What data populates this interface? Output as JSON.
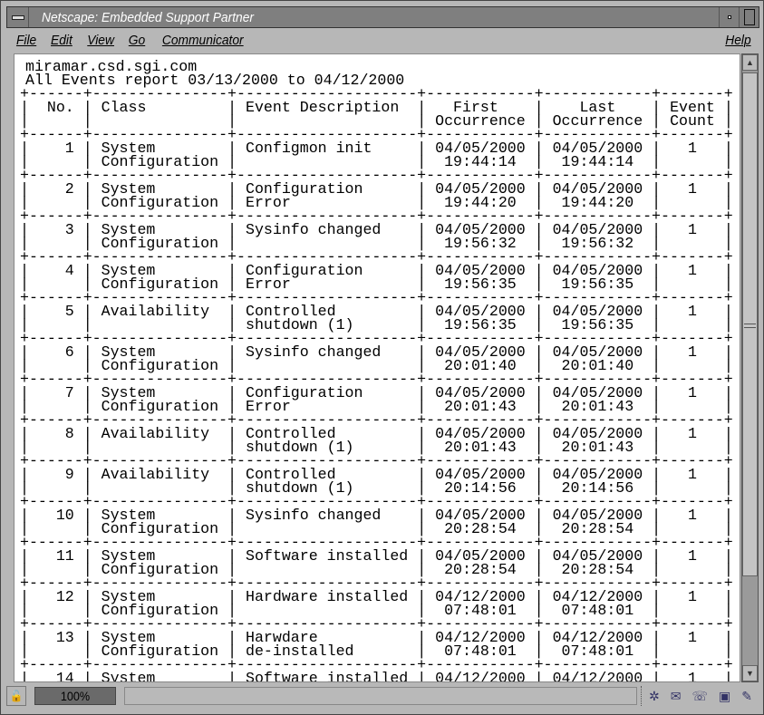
{
  "window": {
    "title": "Netscape: Embedded Support Partner"
  },
  "menu": [
    "File",
    "Edit",
    "View",
    "Go",
    "Communicator"
  ],
  "help": "Help",
  "report": {
    "host": "miramar.csd.sgi.com",
    "title": "All Events report 03/13/2000 to 04/12/2000",
    "headers": [
      [
        "No.",
        ""
      ],
      [
        "Class",
        ""
      ],
      [
        "Event Description",
        ""
      ],
      [
        "First",
        "Occurrence"
      ],
      [
        "Last",
        "Occurrence"
      ],
      [
        "Event",
        "Count"
      ]
    ],
    "rows": [
      {
        "no": "1",
        "class": [
          "System",
          "Configuration"
        ],
        "desc": [
          "Configmon init",
          ""
        ],
        "first": [
          "04/05/2000",
          "19:44:14"
        ],
        "last": [
          "04/05/2000",
          "19:44:14"
        ],
        "count": "1"
      },
      {
        "no": "2",
        "class": [
          "System",
          "Configuration"
        ],
        "desc": [
          "Configuration",
          "Error"
        ],
        "first": [
          "04/05/2000",
          "19:44:20"
        ],
        "last": [
          "04/05/2000",
          "19:44:20"
        ],
        "count": "1"
      },
      {
        "no": "3",
        "class": [
          "System",
          "Configuration"
        ],
        "desc": [
          "Sysinfo changed",
          ""
        ],
        "first": [
          "04/05/2000",
          "19:56:32"
        ],
        "last": [
          "04/05/2000",
          "19:56:32"
        ],
        "count": "1"
      },
      {
        "no": "4",
        "class": [
          "System",
          "Configuration"
        ],
        "desc": [
          "Configuration",
          "Error"
        ],
        "first": [
          "04/05/2000",
          "19:56:35"
        ],
        "last": [
          "04/05/2000",
          "19:56:35"
        ],
        "count": "1"
      },
      {
        "no": "5",
        "class": [
          "Availability",
          ""
        ],
        "desc": [
          "Controlled",
          "shutdown (1)"
        ],
        "first": [
          "04/05/2000",
          "19:56:35"
        ],
        "last": [
          "04/05/2000",
          "19:56:35"
        ],
        "count": "1"
      },
      {
        "no": "6",
        "class": [
          "System",
          "Configuration"
        ],
        "desc": [
          "Sysinfo changed",
          ""
        ],
        "first": [
          "04/05/2000",
          "20:01:40"
        ],
        "last": [
          "04/05/2000",
          "20:01:40"
        ],
        "count": "1"
      },
      {
        "no": "7",
        "class": [
          "System",
          "Configuration"
        ],
        "desc": [
          "Configuration",
          "Error"
        ],
        "first": [
          "04/05/2000",
          "20:01:43"
        ],
        "last": [
          "04/05/2000",
          "20:01:43"
        ],
        "count": "1"
      },
      {
        "no": "8",
        "class": [
          "Availability",
          ""
        ],
        "desc": [
          "Controlled",
          "shutdown (1)"
        ],
        "first": [
          "04/05/2000",
          "20:01:43"
        ],
        "last": [
          "04/05/2000",
          "20:01:43"
        ],
        "count": "1"
      },
      {
        "no": "9",
        "class": [
          "Availability",
          ""
        ],
        "desc": [
          "Controlled",
          "shutdown (1)"
        ],
        "first": [
          "04/05/2000",
          "20:14:56"
        ],
        "last": [
          "04/05/2000",
          "20:14:56"
        ],
        "count": "1"
      },
      {
        "no": "10",
        "class": [
          "System",
          "Configuration"
        ],
        "desc": [
          "Sysinfo changed",
          ""
        ],
        "first": [
          "04/05/2000",
          "20:28:54"
        ],
        "last": [
          "04/05/2000",
          "20:28:54"
        ],
        "count": "1"
      },
      {
        "no": "11",
        "class": [
          "System",
          "Configuration"
        ],
        "desc": [
          "Software installed",
          ""
        ],
        "first": [
          "04/05/2000",
          "20:28:54"
        ],
        "last": [
          "04/05/2000",
          "20:28:54"
        ],
        "count": "1"
      },
      {
        "no": "12",
        "class": [
          "System",
          "Configuration"
        ],
        "desc": [
          "Hardware installed",
          ""
        ],
        "first": [
          "04/12/2000",
          "07:48:01"
        ],
        "last": [
          "04/12/2000",
          "07:48:01"
        ],
        "count": "1"
      },
      {
        "no": "13",
        "class": [
          "System",
          "Configuration"
        ],
        "desc": [
          "Harwdare",
          "de-installed"
        ],
        "first": [
          "04/12/2000",
          "07:48:01"
        ],
        "last": [
          "04/12/2000",
          "07:48:01"
        ],
        "count": "1"
      },
      {
        "no": "14",
        "class": [
          "System",
          ""
        ],
        "desc": [
          "Software installed",
          ""
        ],
        "first": [
          "04/12/2000",
          ""
        ],
        "last": [
          "04/12/2000",
          ""
        ],
        "count": "1"
      }
    ]
  },
  "status": {
    "zoom": "100%",
    "icons": [
      "security-lock-icon",
      "navigator-icon",
      "mailbox-icon",
      "discussion-icon",
      "composer-icon",
      "edit-icon"
    ]
  },
  "scroll": {
    "position_fraction": 0.0,
    "visible_fraction": 0.82
  }
}
